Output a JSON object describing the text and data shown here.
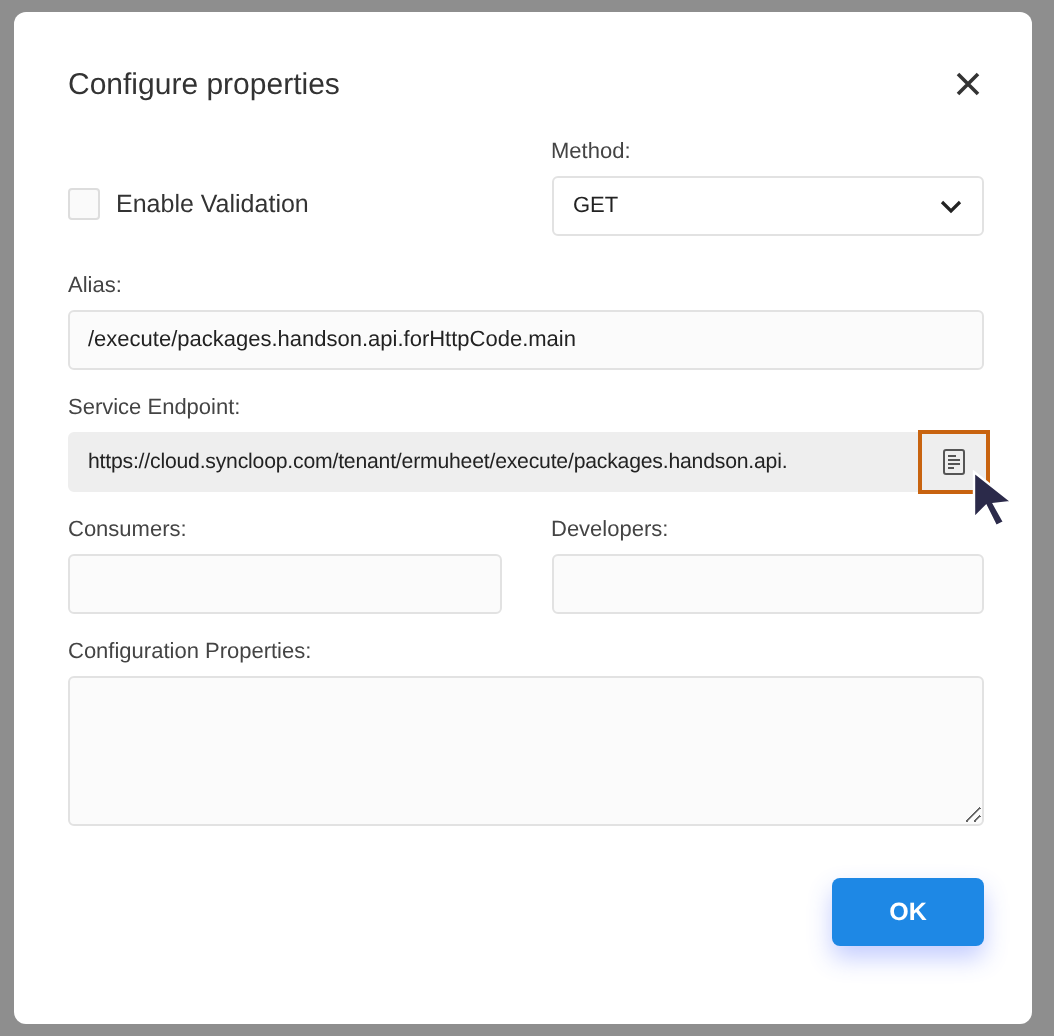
{
  "dialog": {
    "title": "Configure properties",
    "enable_validation": {
      "label": "Enable Validation",
      "checked": false
    },
    "method": {
      "label": "Method:",
      "value": "GET"
    },
    "alias": {
      "label": "Alias:",
      "value": "/execute/packages.handson.api.forHttpCode.main"
    },
    "service_endpoint": {
      "label": "Service Endpoint:",
      "value": "https://cloud.syncloop.com/tenant/ermuheet/execute/packages.handson.api."
    },
    "consumers": {
      "label": "Consumers:"
    },
    "developers": {
      "label": "Developers:"
    },
    "configuration_properties": {
      "label": "Configuration Properties:"
    },
    "buttons": [
      "OK"
    ]
  }
}
